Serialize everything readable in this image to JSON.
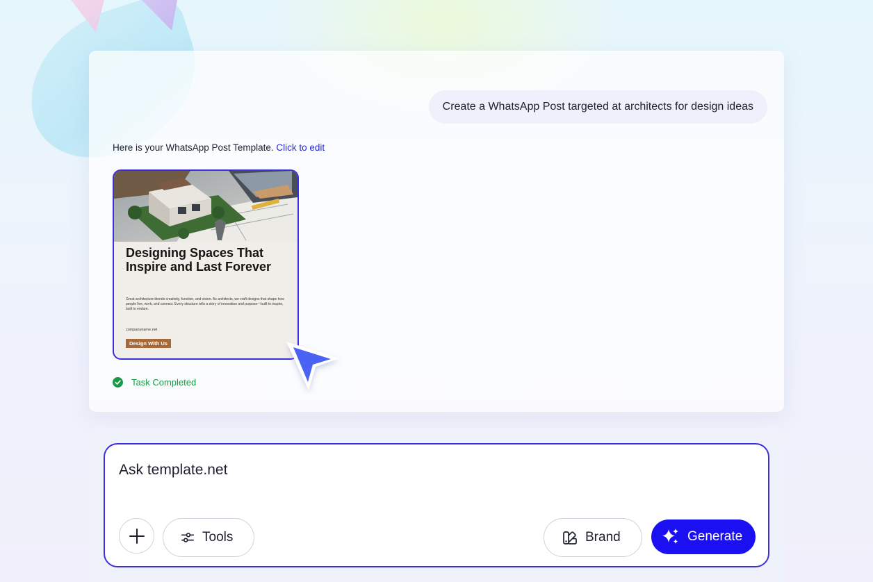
{
  "chat": {
    "user_message": "Create a WhatsApp Post targeted at architects for design ideas",
    "reply_text": "Here is your WhatsApp Post Template.",
    "reply_link": "Click to edit",
    "template": {
      "heading": "Designing Spaces That Inspire and Last Forever",
      "body": "Great architecture blends creativity, function, and vision. As architects, we craft designs that shape how people live, work, and connect. Every structure tells a story of innovation and purpose—built to inspire, built to endure.",
      "website": "companyname.net",
      "cta": "Design With Us"
    },
    "status": "Task Completed"
  },
  "composer": {
    "placeholder": "Ask template.net",
    "tools_label": "Tools",
    "brand_label": "Brand",
    "generate_label": "Generate"
  },
  "colors": {
    "accent": "#3b2ee0",
    "generate": "#1a10f2",
    "success": "#1a9a46",
    "cta": "#a7683a"
  },
  "icons": {
    "status": "check-circle-icon",
    "add": "plus-icon",
    "tools": "sliders-icon",
    "brand": "palette-icon",
    "generate": "sparkles-icon",
    "cursor": "pointer-arrow-icon"
  }
}
